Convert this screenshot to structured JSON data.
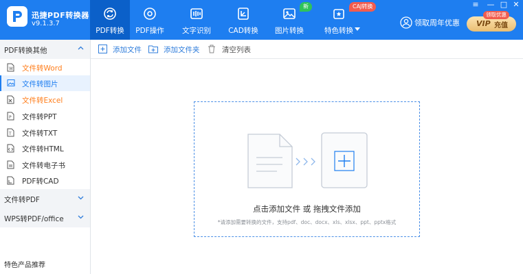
{
  "app": {
    "name": "迅捷PDF转换器",
    "version": "v9.1.3.7"
  },
  "nav": [
    {
      "label": "PDF转换",
      "icon": "refresh-convert-icon",
      "active": true
    },
    {
      "label": "PDF操作",
      "icon": "gear-doc-icon"
    },
    {
      "label": "文字识别",
      "icon": "ocr-icon"
    },
    {
      "label": "CAD转换",
      "icon": "cad-icon"
    },
    {
      "label": "图片转换",
      "icon": "image-icon",
      "badge": "新"
    },
    {
      "label": "特色转换",
      "icon": "special-convert-icon",
      "badge": "CAJ转换"
    }
  ],
  "header": {
    "promo": "领取周年优惠",
    "vip_text": "VIP",
    "vip_action": "充值",
    "vip_tag": "领取优惠"
  },
  "window_controls": {
    "menu": "≡",
    "minimize": "—",
    "maximize": "□",
    "close": "✕"
  },
  "sidebar": {
    "section1": {
      "title": "PDF转换其他",
      "items": [
        {
          "label": "文件转Word",
          "style": "orange"
        },
        {
          "label": "文件转图片",
          "style": "selected"
        },
        {
          "label": "文件转Excel",
          "style": "orange"
        },
        {
          "label": "文件转PPT",
          "style": "normal"
        },
        {
          "label": "文件转TXT",
          "style": "normal"
        },
        {
          "label": "文件转HTML",
          "style": "normal"
        },
        {
          "label": "文件转电子书",
          "style": "normal"
        },
        {
          "label": "PDF转CAD",
          "style": "normal"
        }
      ]
    },
    "section2": {
      "title": "文件转PDF"
    },
    "section3": {
      "title": "WPS转PDF/office"
    },
    "footer": "特色产品推荐"
  },
  "toolbar": {
    "add_file": "添加文件",
    "add_folder": "添加文件夹",
    "clear_list": "清空列表"
  },
  "dropzone": {
    "main": "点击添加文件 或 拖拽文件添加",
    "sub": "*请添加需要转换的文件，支持pdf、doc、docx、xls、xlsx、ppt、pptx格式"
  },
  "colors": {
    "primary": "#1e7ef0",
    "active_nav": "#0b60c9",
    "accent_orange": "#ff7d1a",
    "badge_green": "#2fc35b",
    "badge_red": "#f25c4e"
  }
}
